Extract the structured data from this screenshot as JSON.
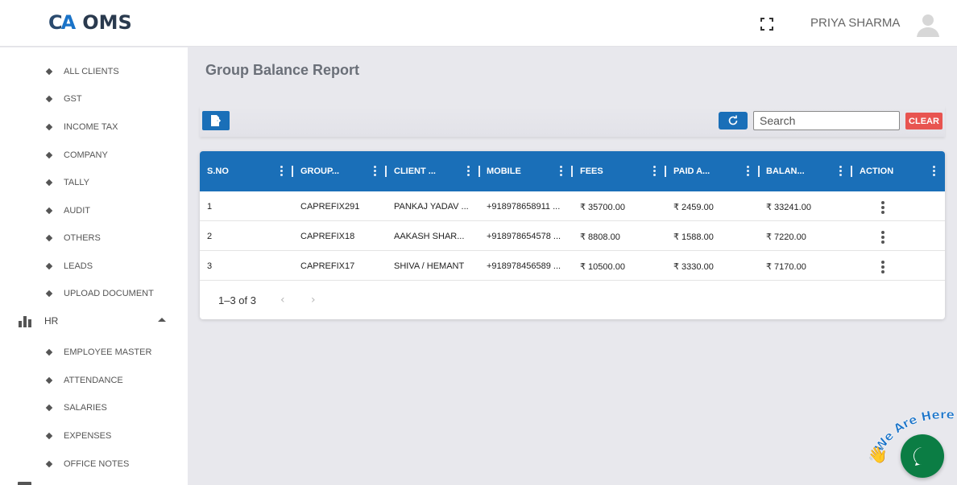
{
  "app": {
    "logo_mark_c": "C",
    "logo_mark_a": "A",
    "name": "OMS"
  },
  "header": {
    "user_name": "PRIYA SHARMA"
  },
  "sidebar": {
    "items": [
      {
        "label": "ALL CLIENTS"
      },
      {
        "label": "GST"
      },
      {
        "label": "INCOME TAX"
      },
      {
        "label": "COMPANY"
      },
      {
        "label": "TALLY"
      },
      {
        "label": "AUDIT"
      },
      {
        "label": "OTHERS"
      },
      {
        "label": "LEADS"
      },
      {
        "label": "UPLOAD DOCUMENT"
      }
    ],
    "group": {
      "label": "HR",
      "icon": "bar-chart-icon",
      "expanded": true
    },
    "hr_items": [
      {
        "label": "EMPLOYEE MASTER"
      },
      {
        "label": "ATTENDANCE"
      },
      {
        "label": "SALARIES"
      },
      {
        "label": "EXPENSES"
      },
      {
        "label": "OFFICE NOTES"
      }
    ]
  },
  "main": {
    "title": "Group Balance Report",
    "search": {
      "placeholder": "Search",
      "value": ""
    },
    "clear_label": "CLEAR"
  },
  "table": {
    "columns": [
      "S.NO",
      "GROUP...",
      "CLIENT ...",
      "MOBILE",
      "FEES",
      "PAID A...",
      "BALAN...",
      "ACTION"
    ],
    "rows": [
      {
        "sno": "1",
        "group": "CAPREFIX291",
        "client": "PANKAJ YADAV ...",
        "mobile": "+918978658911 ...",
        "fees": "₹ 35700.00",
        "paid": "₹ 2459.00",
        "balance": "₹ 33241.00"
      },
      {
        "sno": "2",
        "group": "CAPREFIX18",
        "client": "AAKASH SHAR...",
        "mobile": "+918978654578 ...",
        "fees": "₹ 8808.00",
        "paid": "₹ 1588.00",
        "balance": "₹ 7220.00"
      },
      {
        "sno": "3",
        "group": "CAPREFIX17",
        "client": "SHIVA / HEMANT",
        "mobile": "+918978456589 ...",
        "fees": "₹ 10500.00",
        "paid": "₹ 3330.00",
        "balance": "₹ 7170.00"
      }
    ],
    "pagination": "1–3 of 3"
  },
  "chat_widget": {
    "tagline": "We Are Here!"
  },
  "colors": {
    "primary": "#1a6fb8",
    "danger": "#e85450",
    "chat": "#0b7d44"
  }
}
